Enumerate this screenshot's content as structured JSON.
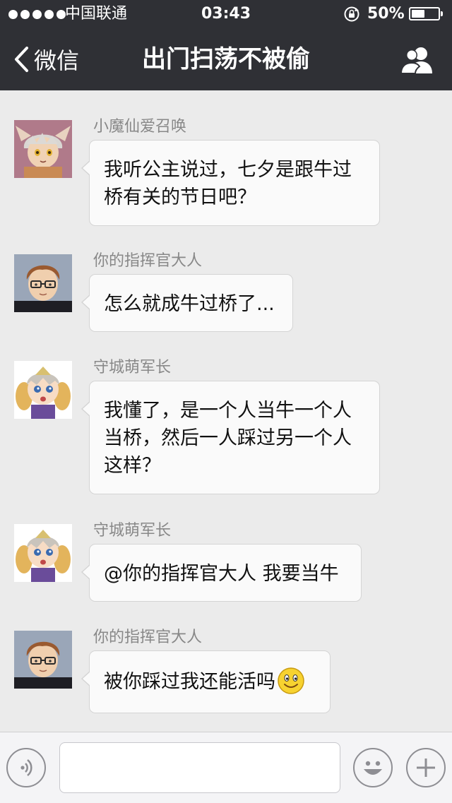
{
  "status_bar": {
    "carrier": "中国联通",
    "time": "03:43",
    "battery": "50%",
    "battery_level": 0.5
  },
  "nav": {
    "back_label": "微信",
    "title": "出门扫荡不被偷",
    "contacts_icon": "group-members-icon"
  },
  "messages": [
    {
      "sender": "小魔仙爱召唤",
      "lines": [
        "我听公主说过，七夕是跟牛过",
        "桥有关的节日吧？"
      ],
      "avatar": "fox-eared-boy-avatar"
    },
    {
      "sender": "你的指挥官大人",
      "lines": [
        "怎么就成牛过桥了..."
      ],
      "avatar": "glasses-man-avatar"
    },
    {
      "sender": "守城萌军长",
      "lines": [
        "我懂了，是一个人当牛一个人",
        "当桥，然后一人踩过另一个人",
        "这样？"
      ],
      "avatar": "blonde-knight-girl-avatar"
    },
    {
      "sender": "守城萌军长",
      "lines": [
        "@你的指挥官大人 我要当牛"
      ],
      "avatar": "blonde-knight-girl-avatar"
    },
    {
      "sender": "你的指挥官大人",
      "lines": [
        "被你踩过我还能活吗"
      ],
      "emoji": "smiley-emoji",
      "avatar": "glasses-man-avatar"
    }
  ],
  "input_bar": {
    "voice_icon": "voice-input-icon",
    "text_value": "",
    "emoji_icon": "emoji-icon",
    "more_icon": "plus-icon"
  },
  "colors": {
    "header_bg": "#2f3035",
    "chat_bg": "#ebebeb",
    "bubble_bg": "#fafafa",
    "sender_text": "#888888"
  }
}
